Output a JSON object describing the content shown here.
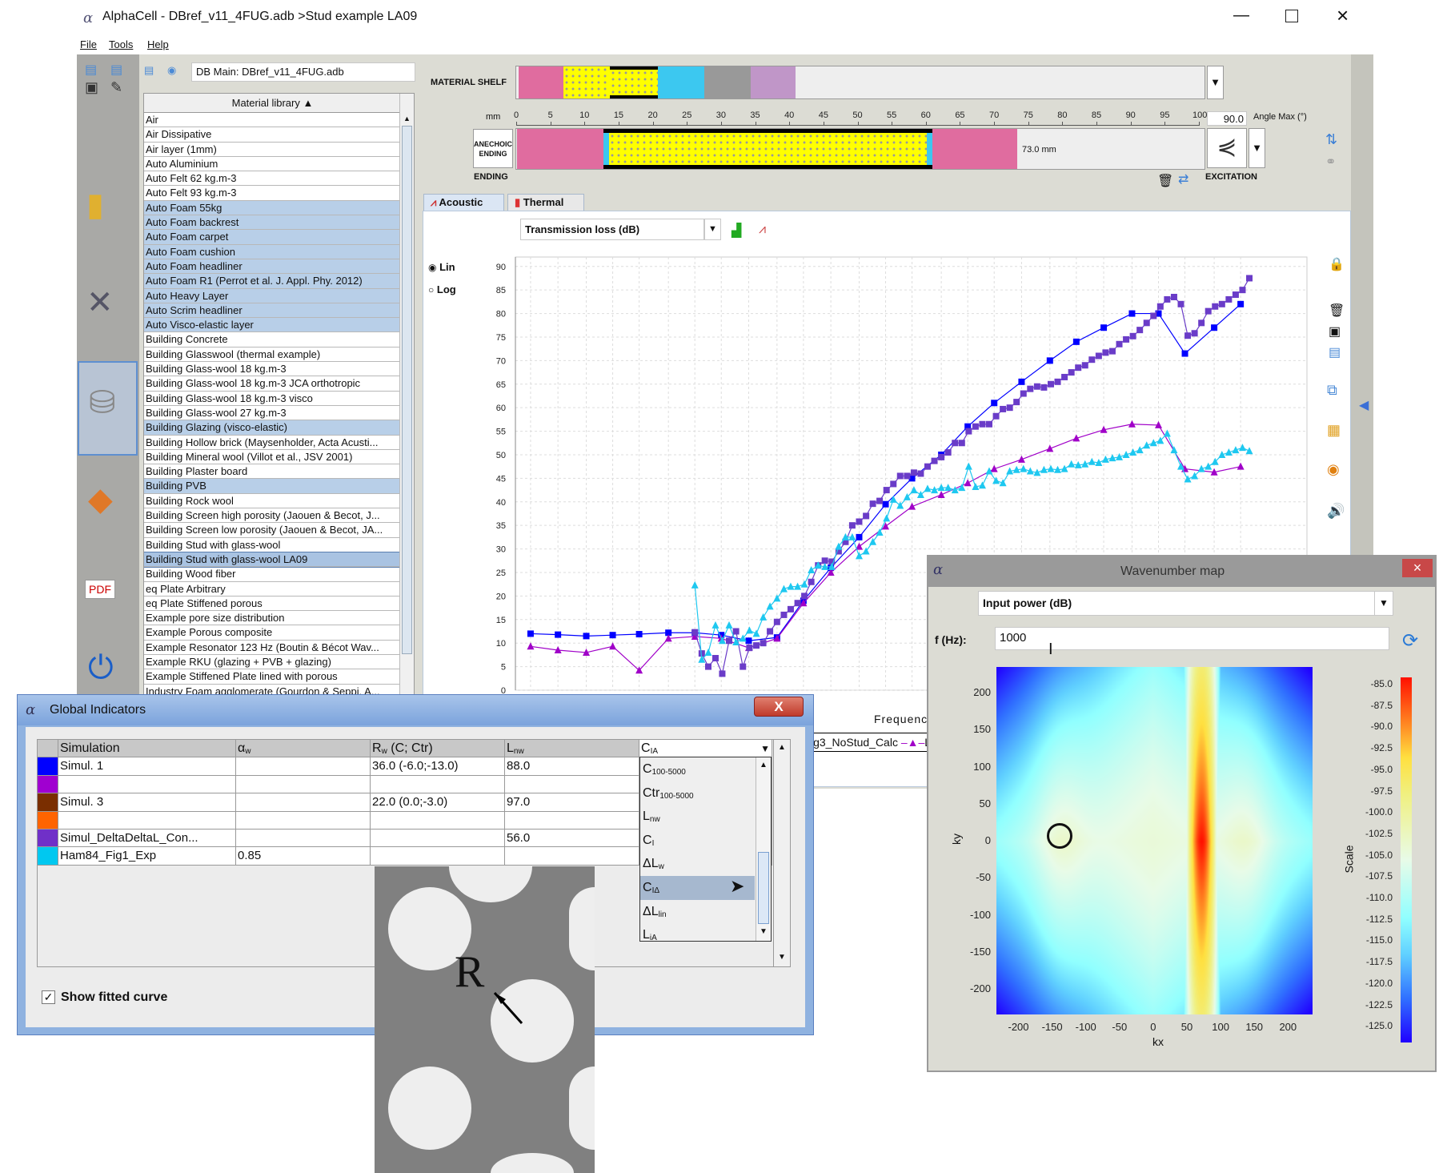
{
  "window": {
    "title": "AlphaCell - DBref_v11_4FUG.adb >Stud example LA09",
    "logo": "α",
    "controls": [
      "minimize",
      "maximize",
      "close"
    ]
  },
  "menu": [
    "File",
    "Tools",
    "Help"
  ],
  "db": {
    "value": "DB Main: DBref_v11_4FUG.adb"
  },
  "material_library": {
    "header": "Material library ▲",
    "items": [
      {
        "label": "Air"
      },
      {
        "label": "Air Dissipative"
      },
      {
        "label": "Air layer (1mm)"
      },
      {
        "label": "Auto Aluminium"
      },
      {
        "label": "Auto Felt 62 kg.m-3"
      },
      {
        "label": "Auto Felt 93 kg.m-3"
      },
      {
        "label": "Auto Foam 55kg",
        "selected": true
      },
      {
        "label": "Auto Foam backrest",
        "selected": true
      },
      {
        "label": "Auto Foam carpet",
        "selected": true
      },
      {
        "label": "Auto Foam cushion",
        "selected": true
      },
      {
        "label": "Auto Foam headliner",
        "selected": true
      },
      {
        "label": "Auto Foam R1 (Perrot et al. J. Appl. Phy. 2012)",
        "selected": true
      },
      {
        "label": "Auto Heavy Layer",
        "selected": true
      },
      {
        "label": "Auto Scrim headliner",
        "selected": true
      },
      {
        "label": "Auto Visco-elastic layer",
        "selected": true
      },
      {
        "label": "Building Concrete"
      },
      {
        "label": "Building Glasswool (thermal example)"
      },
      {
        "label": "Building Glass-wool 18 kg.m-3"
      },
      {
        "label": "Building Glass-wool 18 kg.m-3 JCA orthotropic"
      },
      {
        "label": "Building Glass-wool 18 kg.m-3 visco"
      },
      {
        "label": "Building Glass-wool 27 kg.m-3"
      },
      {
        "label": "Building Glazing (visco-elastic)",
        "selected": true
      },
      {
        "label": "Building Hollow brick (Maysenholder, Acta Acusti..."
      },
      {
        "label": "Building Mineral wool (Villot et al., JSV 2001)"
      },
      {
        "label": "Building Plaster board"
      },
      {
        "label": "Building PVB",
        "selected": true
      },
      {
        "label": "Building Rock wool"
      },
      {
        "label": "Building Screen high porosity (Jaouen & Becot, J..."
      },
      {
        "label": "Building Screen low porosity (Jaouen & Becot, JA..."
      },
      {
        "label": "Building Stud with glass-wool"
      },
      {
        "label": "Building Stud with glass-wool LA09",
        "selected": true,
        "current": true
      },
      {
        "label": "Building Wood fiber"
      },
      {
        "label": "eq Plate Arbitrary"
      },
      {
        "label": "eq Plate Stiffened porous"
      },
      {
        "label": "Example pore size distribution"
      },
      {
        "label": "Example Porous composite"
      },
      {
        "label": "Example Resonator 123 Hz (Boutin & Bécot Wav..."
      },
      {
        "label": "Example RKU (glazing + PVB + glazing)"
      },
      {
        "label": "Example Stiffened Plate lined with porous"
      },
      {
        "label": "Industry Foam agglomerate (Gourdon & Seppi, A..."
      }
    ]
  },
  "shelf": {
    "label": "MATERIAL SHELF",
    "colors": [
      "#e06c9f",
      "porous",
      "porous-framed",
      "#3cc8f0",
      "#999999",
      "#c096c8"
    ]
  },
  "ruler": {
    "unit": "mm",
    "ticks": [
      "0",
      "5",
      "10",
      "15",
      "20",
      "25",
      "30",
      "35",
      "40",
      "45",
      "50",
      "55",
      "60",
      "65",
      "70",
      "75",
      "80",
      "85",
      "90",
      "95",
      "100"
    ]
  },
  "angle": {
    "value": "90.0",
    "label": "Angle Max (°)"
  },
  "stack": {
    "ending_box": [
      "ANECHOIC",
      "ENDING"
    ],
    "ending_label": "ENDING",
    "excitation_label": "EXCITATION",
    "total": "73.0 mm",
    "layers": [
      {
        "type": "plate",
        "color": "#e06c9f",
        "from_mm": 0,
        "to_mm": 12.7
      },
      {
        "type": "porous",
        "color": "#ffff00",
        "from_mm": 12.7,
        "to_mm": 60.2
      },
      {
        "type": "plate",
        "color": "#e06c9f",
        "from_mm": 60.2,
        "to_mm": 73.0
      }
    ]
  },
  "tabs": [
    {
      "label": "Acoustic",
      "active": true
    },
    {
      "label": "Thermal"
    }
  ],
  "indicator_select": "Transmission loss (dB)",
  "scale_mode": {
    "options": [
      "Lin",
      "Log"
    ],
    "selected": "Lin"
  },
  "chart_data": {
    "type": "line",
    "xlabel": "Frequency",
    "ylabel": "",
    "xscale": "log",
    "xlim": [
      44,
      35000
    ],
    "ylim": [
      0,
      92
    ],
    "yticks": [
      0,
      5,
      10,
      15,
      20,
      25,
      30,
      35,
      40,
      45,
      50,
      55,
      60,
      65,
      70,
      75,
      80,
      85,
      90
    ],
    "grid": true,
    "legend_visible": [
      "ig3_NoStud_Calc",
      "L"
    ],
    "x_third_octave": [
      50,
      63,
      80,
      100,
      125,
      160,
      200,
      250,
      315,
      400,
      500,
      630,
      800,
      1000,
      1250,
      1600,
      2000,
      2500,
      3150,
      4000,
      5000,
      6300,
      8000,
      10000,
      12500,
      16000,
      20000
    ],
    "x_twelfth_octave": [
      200,
      212,
      224,
      238,
      252,
      267,
      283,
      300,
      317,
      336,
      356,
      377,
      400,
      424,
      449,
      476,
      504,
      534,
      566,
      599,
      635,
      673,
      713,
      755,
      800,
      848,
      898,
      951,
      1008,
      1068,
      1131,
      1199,
      1270,
      1345,
      1425,
      1510,
      1600,
      1695,
      1796,
      1903,
      2016,
      2136,
      2263,
      2397,
      2540,
      2691,
      2851,
      3020,
      3200,
      3390,
      3592,
      3805,
      4032,
      4271,
      4525,
      4795,
      5080,
      5382,
      5702,
      6041,
      6400,
      6780,
      7184,
      7611,
      8063,
      8543,
      9051,
      9589,
      10159,
      10763,
      11404,
      12082,
      12800,
      13561,
      14368,
      15222,
      16127,
      17086,
      18102,
      19179,
      20319,
      21527
    ],
    "series": [
      {
        "color": "#0000ff",
        "marker": "square",
        "x_ref": "x_third_octave",
        "values": [
          12,
          11.8,
          11.5,
          11.7,
          11.9,
          12.2,
          12.2,
          11.7,
          10.5,
          11.2,
          19,
          26,
          32.5,
          39.5,
          45,
          50,
          56,
          61,
          65.5,
          70,
          74,
          77,
          80,
          80,
          71.5,
          77,
          82
        ]
      },
      {
        "color": "#a000c8",
        "marker": "triangle",
        "x_ref": "x_third_octave",
        "values": [
          9.3,
          8.5,
          8,
          9.3,
          4.2,
          11,
          11.4,
          11,
          9,
          11,
          18.5,
          25,
          30.5,
          34.8,
          39,
          41.5,
          44,
          47,
          49,
          51.3,
          53.5,
          55.3,
          56.5,
          56.3,
          47,
          46.3,
          47.5
        ]
      },
      {
        "color": "#6a3cc8",
        "marker": "square",
        "x_ref": "x_twelfth_octave",
        "values": [
          12.3,
          7.8,
          5,
          6.8,
          3.5,
          10.5,
          12.5,
          5,
          9,
          9.5,
          10,
          12.5,
          14.5,
          16,
          17.2,
          18.5,
          20,
          23,
          26.5,
          27.5,
          27.3,
          29.5,
          31.5,
          35,
          35.8,
          37,
          39.6,
          40.2,
          42.5,
          43.8,
          45.5,
          45.5,
          46.2,
          46,
          47.5,
          48.7,
          49.5,
          50.5,
          52.5,
          52.5,
          55,
          56,
          56.5,
          56.5,
          58.2,
          59.7,
          60,
          61.2,
          63,
          64,
          64.5,
          64.3,
          65,
          65.5,
          66.5,
          67.5,
          68.5,
          69,
          70.2,
          71,
          71.7,
          72,
          73.5,
          74.5,
          75.2,
          76.5,
          78,
          79.5,
          81.5,
          83,
          83.5,
          82,
          75.3,
          75.8,
          78,
          80.5,
          81.5,
          82,
          83,
          84,
          85,
          87.5
        ]
      },
      {
        "color": "#1ec8f0",
        "marker": "triangle",
        "x_ref": "x_twelfth_octave",
        "values": [
          22.3,
          6.5,
          8,
          13.8,
          10.5,
          13.8,
          10.2,
          11,
          12.7,
          12,
          15.5,
          17.8,
          19.5,
          21.5,
          22,
          22,
          22.5,
          25.5,
          26.5,
          26.2,
          26.2,
          30.5,
          32.5,
          32.5,
          28.5,
          29.5,
          31.5,
          33.5,
          36.5,
          40.5,
          39.2,
          41,
          42.5,
          41.5,
          42.8,
          42.5,
          43,
          43,
          42.5,
          43,
          47.5,
          43.2,
          43.5,
          46.5,
          44.5,
          44,
          46.5,
          46.8,
          47,
          46.5,
          46.2,
          46.8,
          47,
          46.8,
          47,
          48,
          47.8,
          48,
          48.5,
          48.3,
          49,
          49.3,
          49.5,
          50,
          50.5,
          51,
          52,
          52.5,
          53,
          54.5,
          51,
          47.5,
          44.8,
          45.5,
          47,
          47.5,
          48.5,
          50,
          50.5,
          51,
          51.5,
          50.8
        ]
      }
    ]
  },
  "global_indicators": {
    "title": "Global Indicators",
    "columns": [
      {
        "main": "Simulation",
        "sub": ""
      },
      {
        "main": "α",
        "sub": "w",
        "rest": ""
      },
      {
        "main": "R",
        "sub": "w",
        "rest": " (C; Ctr)"
      },
      {
        "main": "L",
        "sub": "nw",
        "rest": ""
      }
    ],
    "dropdown_column": {
      "main": "C",
      "sub": "IA"
    },
    "rows": [
      {
        "color": "#0000ff",
        "name": "Simul. 1",
        "aw": "",
        "rw": "36.0 (-6.0;-13.0)",
        "lnw": "88.0"
      },
      {
        "color": "#a000d0",
        "name": "",
        "aw": "",
        "rw": "",
        "lnw": ""
      },
      {
        "color": "#7a2e00",
        "name": "Simul. 3",
        "aw": "",
        "rw": "22.0 (0.0;-3.0)",
        "lnw": "97.0"
      },
      {
        "color": "#ff6400",
        "name": "",
        "aw": "",
        "rw": "",
        "lnw": ""
      },
      {
        "color": "#7030c8",
        "name": "Simul_DeltaDeltaL_Con...",
        "aw": "",
        "rw": "",
        "lnw": "56.0"
      },
      {
        "color": "#00c8f0",
        "name": "Ham84_Fig1_Exp",
        "aw": "0.85",
        "rw": "",
        "lnw": ""
      }
    ],
    "dropdown_options": [
      {
        "main": "C",
        "sub": "100-5000"
      },
      {
        "main": "Ctr",
        "sub": "100-5000"
      },
      {
        "main": "L",
        "sub": "nw"
      },
      {
        "main": "C",
        "sub": "I"
      },
      {
        "main": "ΔL",
        "sub": "w"
      },
      {
        "main": "C",
        "sub": "IΔ",
        "selected": true
      },
      {
        "main": "ΔL",
        "sub": "lin"
      },
      {
        "main": "L",
        "sub": "iA"
      }
    ],
    "show_fitted_curve": {
      "label": "Show fitted curve",
      "checked": true
    }
  },
  "perforated_plate": {
    "label": "R"
  },
  "wavenumber_map": {
    "title": "Wavenumber map",
    "quantity": "Input power (dB)",
    "freq_label": "f (Hz):",
    "freq_value": "1000",
    "xlabel": "kx",
    "ylabel": "ky",
    "colorbar_label": "Scale",
    "xticks": [
      "-200",
      "-150",
      "-100",
      "-50",
      "0",
      "50",
      "100",
      "150",
      "200"
    ],
    "yticks": [
      "200",
      "150",
      "100",
      "50",
      "0",
      "-50",
      "-100",
      "-150",
      "-200"
    ],
    "colorbar_ticks": [
      "-85.0",
      "-87.5",
      "-90.0",
      "-92.5",
      "-95.0",
      "-97.5",
      "-100.0",
      "-102.5",
      "-105.0",
      "-107.5",
      "-110.0",
      "-112.5",
      "-115.0",
      "-117.5",
      "-120.0",
      "-122.5",
      "-125.0"
    ],
    "range": [
      -125,
      -85
    ],
    "peak_kx": 72,
    "marker_circle_at": [
      0,
      0
    ]
  }
}
